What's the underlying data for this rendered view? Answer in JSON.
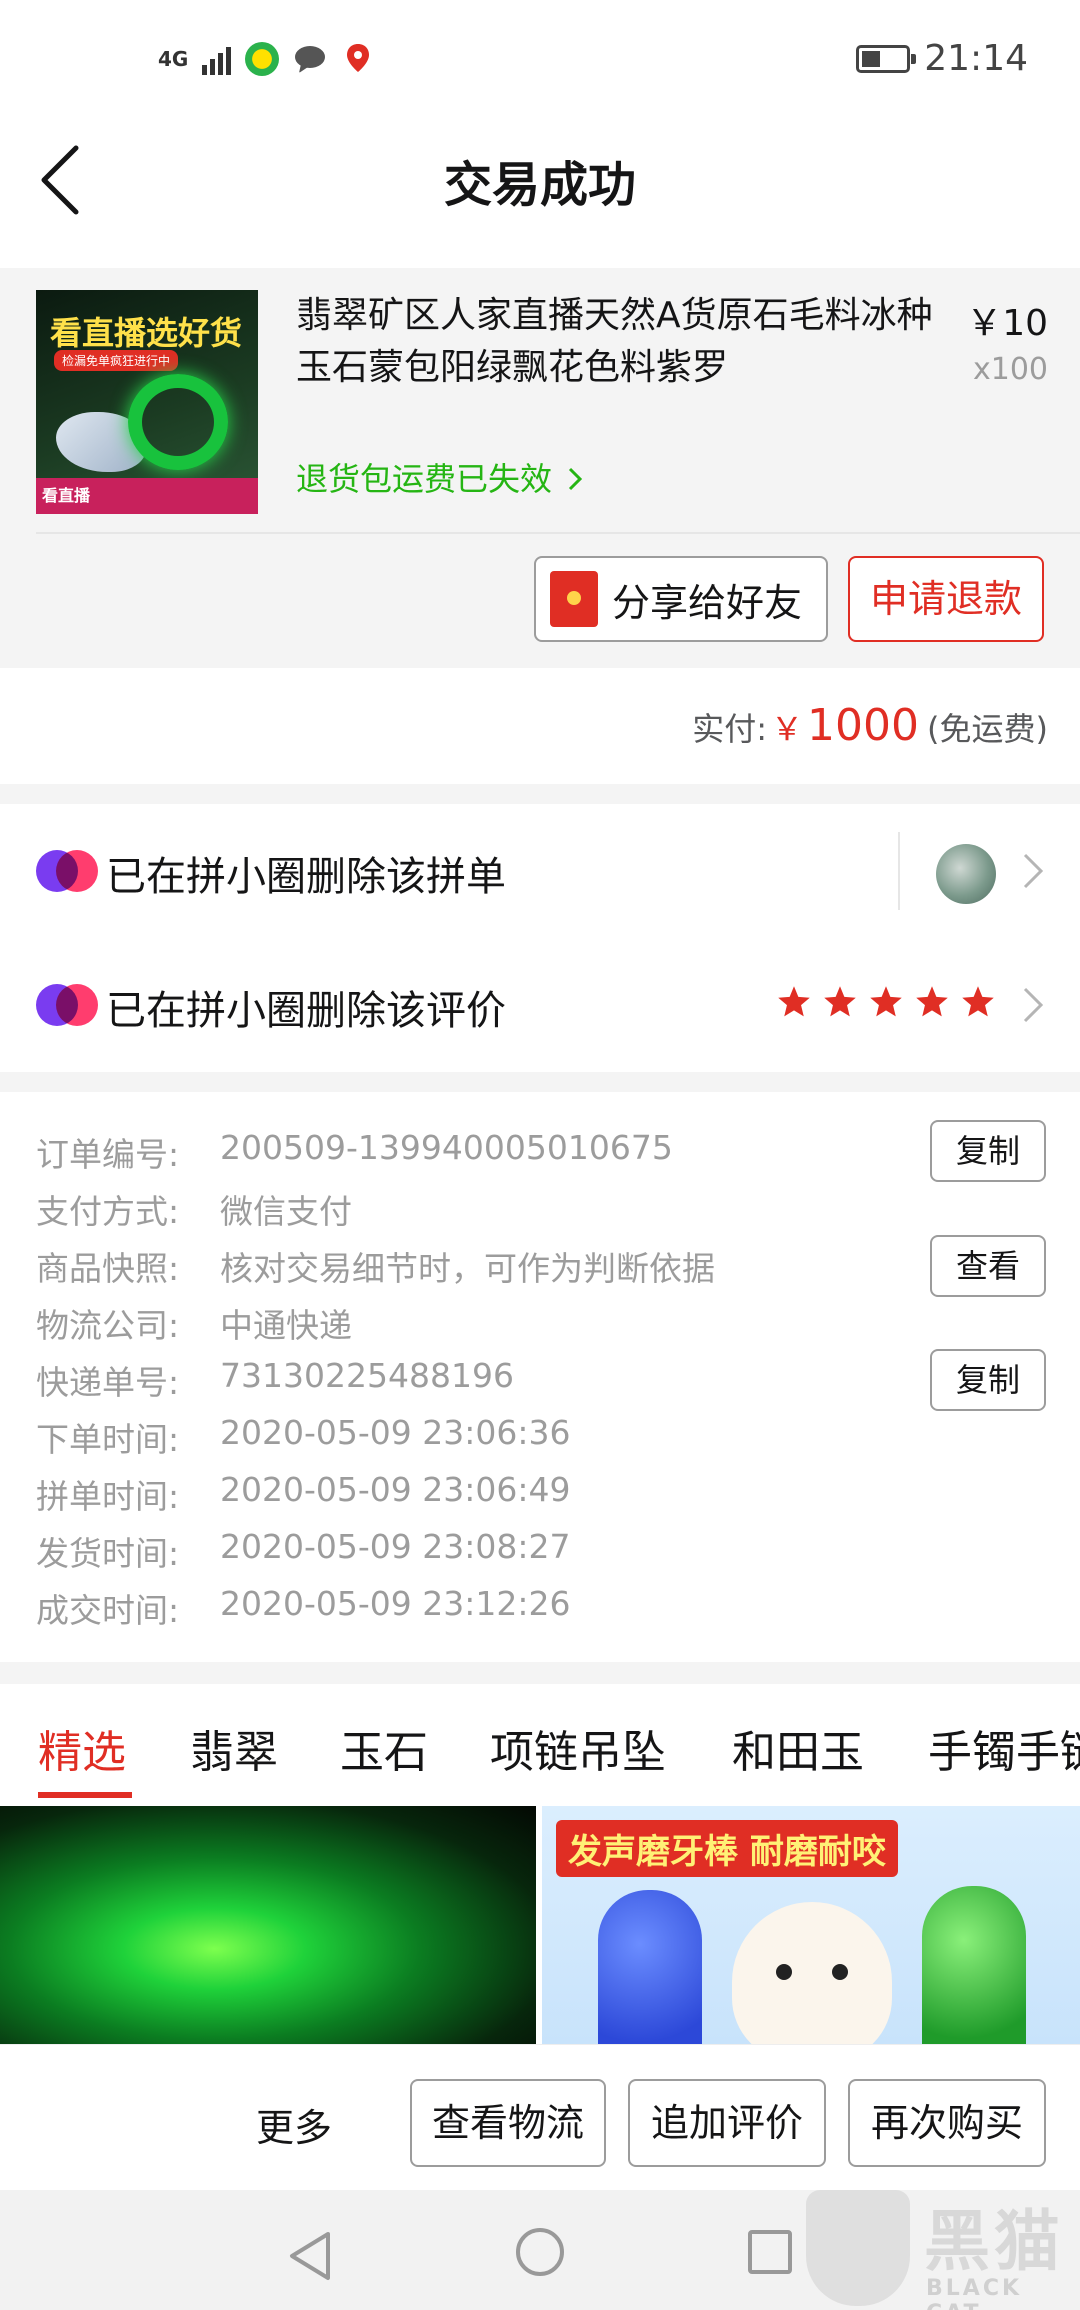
{
  "status_bar": {
    "signal": "4G",
    "time": "21:14"
  },
  "nav": {
    "title": "交易成功"
  },
  "product": {
    "thumb_title": "看直播选好货",
    "thumb_subtitle": "检漏免单疯狂进行中",
    "thumb_badge": "看直播",
    "title": "翡翠矿区人家直播天然A货原石毛料冰种玉石蒙包阳绿飘花色料紫罗",
    "price": "￥10",
    "quantity": "x100",
    "return_note": "退货包运费已失效",
    "share_button": "分享给好友",
    "refund_button": "申请退款"
  },
  "payment": {
    "label": "实付:",
    "currency": "￥",
    "amount": "1000",
    "shipping_note": "(免运费)"
  },
  "circle_rows": [
    {
      "text": "已在拼小圈删除该拼单"
    },
    {
      "text": "已在拼小圈删除该评价",
      "rating": 5
    }
  ],
  "order_info": [
    {
      "label": "订单编号:",
      "value": "200509-139940005010675",
      "button": "复制"
    },
    {
      "label": "支付方式:",
      "value": "微信支付"
    },
    {
      "label": "商品快照:",
      "value": "核对交易细节时，可作为判断依据",
      "button": "查看"
    },
    {
      "label": "物流公司:",
      "value": "中通快递"
    },
    {
      "label": "快递单号:",
      "value": "73130225488196",
      "button": "复制"
    },
    {
      "label": "下单时间:",
      "value": "2020-05-09 23:06:36"
    },
    {
      "label": "拼单时间:",
      "value": "2020-05-09 23:06:49"
    },
    {
      "label": "发货时间:",
      "value": "2020-05-09 23:08:27"
    },
    {
      "label": "成交时间:",
      "value": "2020-05-09 23:12:26"
    }
  ],
  "tabs": [
    "精选",
    "翡翠",
    "玉石",
    "项链吊坠",
    "和田玉",
    "手镯手链"
  ],
  "active_tab": 0,
  "recommendations": {
    "item2_tag": "发声磨牙棒 耐磨耐咬"
  },
  "bottom_bar": {
    "more": "更多",
    "buttons": [
      "查看物流",
      "追加评价",
      "再次购买"
    ]
  },
  "watermark": {
    "cn": "黑猫",
    "en": "BLACK CAT"
  },
  "colors": {
    "accent": "#e02e24",
    "green_link": "#25b513",
    "muted_text": "#9c9c9c"
  }
}
